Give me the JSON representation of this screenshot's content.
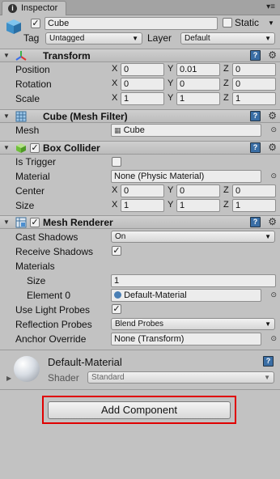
{
  "window": {
    "tab_label": "Inspector",
    "info_icon": "i"
  },
  "object": {
    "name": "Cube",
    "active": true,
    "static_label": "Static",
    "static_checked": false,
    "tag_label": "Tag",
    "tag_value": "Untagged",
    "layer_label": "Layer",
    "layer_value": "Default"
  },
  "transform": {
    "title": "Transform",
    "rows": [
      {
        "label": "Position",
        "x": "0",
        "y": "0.01",
        "z": "0"
      },
      {
        "label": "Rotation",
        "x": "0",
        "y": "0",
        "z": "0"
      },
      {
        "label": "Scale",
        "x": "1",
        "y": "1",
        "z": "1"
      }
    ]
  },
  "axes": {
    "x": "X",
    "y": "Y",
    "z": "Z"
  },
  "mesh_filter": {
    "title": "Cube (Mesh Filter)",
    "mesh_label": "Mesh",
    "mesh_value": "Cube"
  },
  "box_collider": {
    "title": "Box Collider",
    "enabled": true,
    "is_trigger_label": "Is Trigger",
    "is_trigger": false,
    "material_label": "Material",
    "material_value": "None (Physic Material)",
    "center_label": "Center",
    "center": {
      "x": "0",
      "y": "0",
      "z": "0"
    },
    "size_label": "Size",
    "size": {
      "x": "1",
      "y": "1",
      "z": "1"
    }
  },
  "mesh_renderer": {
    "title": "Mesh Renderer",
    "enabled": true,
    "cast_shadows_label": "Cast Shadows",
    "cast_shadows_value": "On",
    "receive_shadows_label": "Receive Shadows",
    "receive_shadows": true,
    "materials_label": "Materials",
    "size_label": "Size",
    "size_value": "1",
    "element0_label": "Element 0",
    "element0_value": "Default-Material",
    "light_probes_label": "Use Light Probes",
    "light_probes": true,
    "reflection_probes_label": "Reflection Probes",
    "reflection_probes_value": "Blend Probes",
    "anchor_override_label": "Anchor Override",
    "anchor_override_value": "None (Transform)"
  },
  "material": {
    "name": "Default-Material",
    "shader_label": "Shader",
    "shader_value": "Standard"
  },
  "add_component_label": "Add Component",
  "colors": {
    "highlight": "#e00000",
    "help_icon": "#3a6ea5"
  }
}
